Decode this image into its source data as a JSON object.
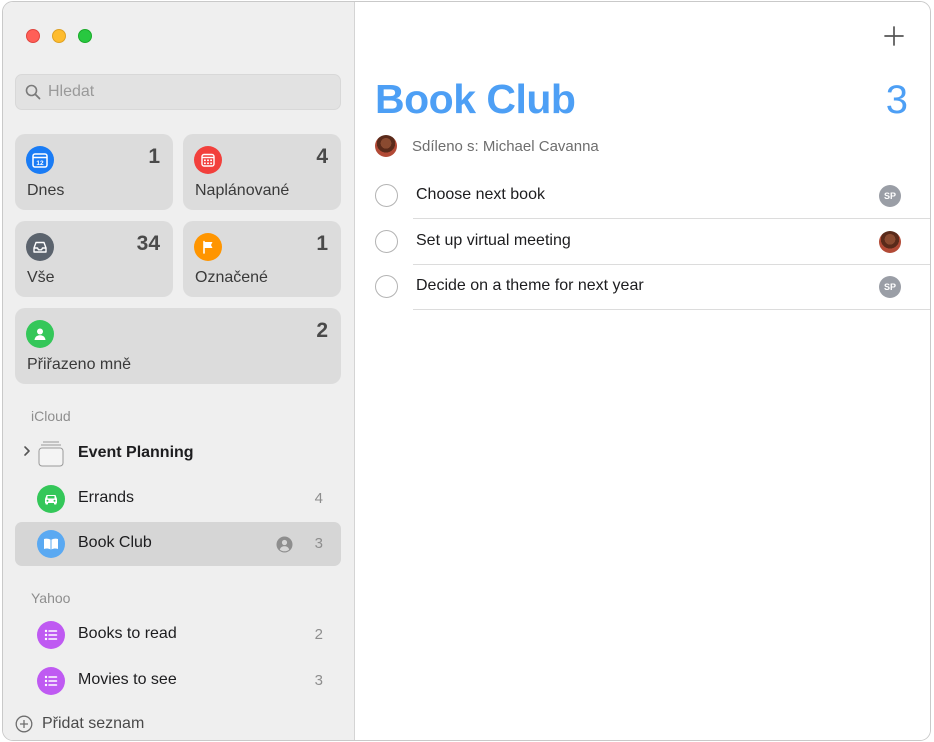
{
  "colors": {
    "accent": "#4d9ff5",
    "today": "#1a7cf5",
    "scheduled": "#f2403c",
    "all": "#5b636d",
    "flagged": "#ff9500",
    "assigned": "#34c759",
    "errands": "#34c759",
    "book_club": "#5aa9f2",
    "yahoo_list": "#bf5af2"
  },
  "sidebar": {
    "search": {
      "placeholder": "Hledat",
      "icon": "magnifier-icon"
    },
    "smart_lists": [
      {
        "label": "Dnes",
        "count": "1",
        "icon": "calendar-today-icon"
      },
      {
        "label": "Naplánované",
        "count": "4",
        "icon": "calendar-grid-icon"
      },
      {
        "label": "Vše",
        "count": "34",
        "icon": "tray-icon"
      },
      {
        "label": "Označené",
        "count": "1",
        "icon": "flag-icon"
      },
      {
        "label": "Přiřazeno mně",
        "count": "2",
        "icon": "person-icon"
      }
    ],
    "today_icon_day": "12",
    "sections": {
      "icloud": "iCloud",
      "yahoo": "Yahoo"
    },
    "icloud_group": {
      "name": "Event Planning",
      "icon": "list-stack-icon"
    },
    "icloud_lists": [
      {
        "name": "Errands",
        "count": "4",
        "icon": "car-icon"
      },
      {
        "name": "Book Club",
        "count": "3",
        "icon": "book-icon",
        "shared_icon": "person-circle-icon",
        "selected": true
      }
    ],
    "yahoo_lists": [
      {
        "name": "Books to read",
        "count": "2",
        "icon": "bullet-list-icon"
      },
      {
        "name": "Movies to see",
        "count": "3",
        "icon": "bullet-list-icon"
      }
    ],
    "add_list_label": "Přidat seznam"
  },
  "main": {
    "title": "Book Club",
    "count": "3",
    "shared_with": "Sdíleno s: Michael Cavanna",
    "reminders": [
      {
        "text": "Choose next book",
        "assignee": "SP"
      },
      {
        "text": "Set up virtual meeting",
        "assignee": ""
      },
      {
        "text": "Decide on a theme for next year",
        "assignee": "SP"
      }
    ]
  }
}
